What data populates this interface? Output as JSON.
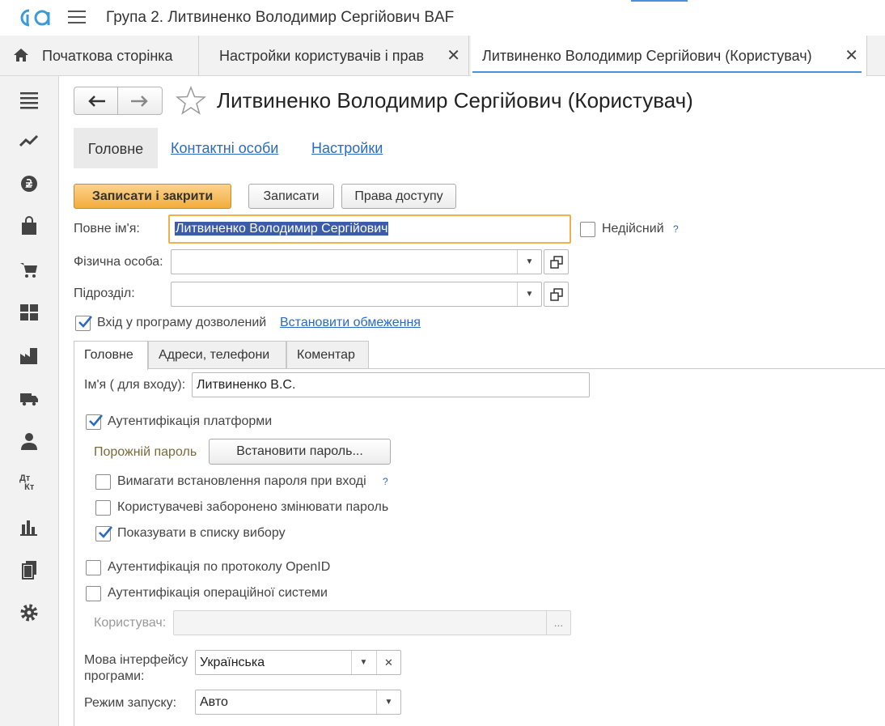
{
  "app": {
    "title": "Група 2. Литвиненко Володимир Сергійович BAF",
    "logo": "1c-logo"
  },
  "page_tabs": [
    {
      "label": "Початкова сторінка",
      "icon": "home-icon"
    },
    {
      "label": "Настройки користувачів і прав",
      "close": "✕"
    },
    {
      "label": "Литвиненко Володимир Сергійович (Користувач)",
      "close": "✕"
    }
  ],
  "sidebar_icons": [
    "menu-icon",
    "trend-icon",
    "currency-icon",
    "bag-icon",
    "cart-icon",
    "grid-icon",
    "factory-icon",
    "truck-icon",
    "person-icon",
    "dt-kt-icon",
    "bar-chart-icon",
    "documents-icon",
    "gear-icon"
  ],
  "form": {
    "title": "Литвиненко Володимир Сергійович (Користувач)",
    "nav_back": "←",
    "nav_fwd": "→",
    "tabs": {
      "main": "Головне",
      "contacts": "Контактні особи",
      "settings": "Настройки"
    },
    "buttons": {
      "save_close": "Записати і закрити",
      "save": "Записати",
      "access": "Права доступу"
    },
    "full_name_label": "Повне ім'я:",
    "full_name_value": "Литвиненко Володимир Сергійович",
    "invalid_label": "Недійсний",
    "help_mark": "?",
    "person_label": "Фізична особа:",
    "person_value": "",
    "department_label": "Підрозділ:",
    "department_value": "",
    "login_allowed_label": "Вхід у програму дозволений",
    "login_allowed_checked": true,
    "set_restrictions_link": "Встановити обмеження",
    "inner_tabs": [
      "Головне",
      "Адреси, телефони",
      "Коментар"
    ],
    "login_name_label": "Ім'я ( для входу):",
    "login_name_value": "Литвиненко В.С.",
    "platform_auth_label": "Аутентифікація платформи",
    "platform_auth_checked": true,
    "empty_password_label": "Порожній пароль",
    "set_password_button": "Встановити пароль...",
    "require_password_label": "Вимагати встановлення пароля при вході",
    "forbid_change_label": "Користувачеві заборонено змінювати пароль",
    "show_in_list_label": "Показувати в списку вибору",
    "show_in_list_checked": true,
    "openid_label": "Аутентифікація по протоколу OpenID",
    "os_auth_label": "Аутентифікація операційної системи",
    "os_user_label": "Користувач:",
    "os_user_value": "",
    "ellipsis": "...",
    "language_label_line1": "Мова інтерфейсу",
    "language_label_line2": "програми:",
    "language_value": "Українська",
    "clear": "✕",
    "mode_label": "Режим запуску:",
    "mode_value": "Авто"
  },
  "colors": {
    "accent": "#4a90d9",
    "primary_button": "#f3ad3c",
    "link": "#2a6bbf",
    "focus": "#f2b04c"
  }
}
